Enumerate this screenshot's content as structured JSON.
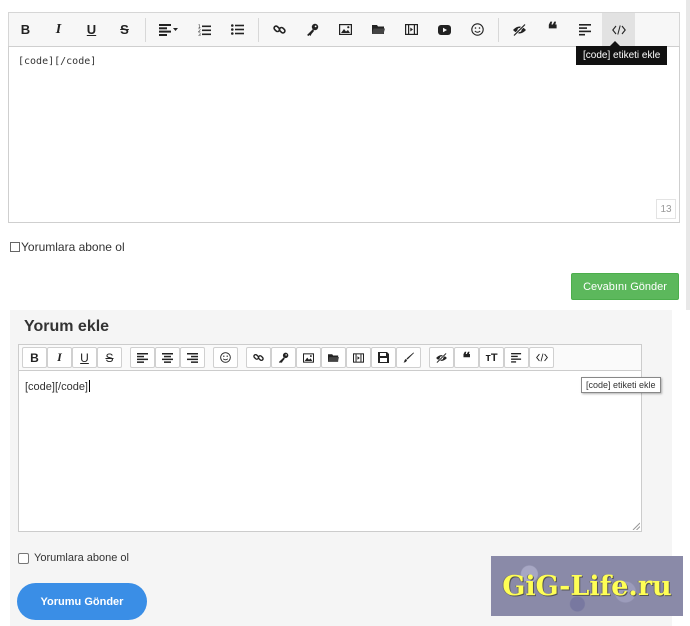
{
  "top_editor": {
    "toolbar": {
      "bold": "B",
      "italic": "I",
      "underline": "U",
      "strike": "S",
      "quote": "❝"
    },
    "content": "[code][/code]",
    "char_count": "13",
    "tooltip": "[code] etiketi ekle",
    "subscribe_label": "Yorumlara abone ol",
    "submit_label": "Cevabını Gönder",
    "submit_color": "#5cb85c"
  },
  "bottom_editor": {
    "title": "Yorum ekle",
    "toolbar": {
      "bold": "B",
      "italic": "I",
      "underline": "U",
      "strike": "S",
      "quote": "❝",
      "font_size": "ᴛT"
    },
    "content": "[code][/code]",
    "tooltip": "[code] etiketi ekle",
    "subscribe_label": "Yorumlara abone ol",
    "submit_label": "Yorumu Gönder",
    "submit_color": "#3a8ee6"
  },
  "watermark": {
    "text": "GiG-Life.ru"
  }
}
